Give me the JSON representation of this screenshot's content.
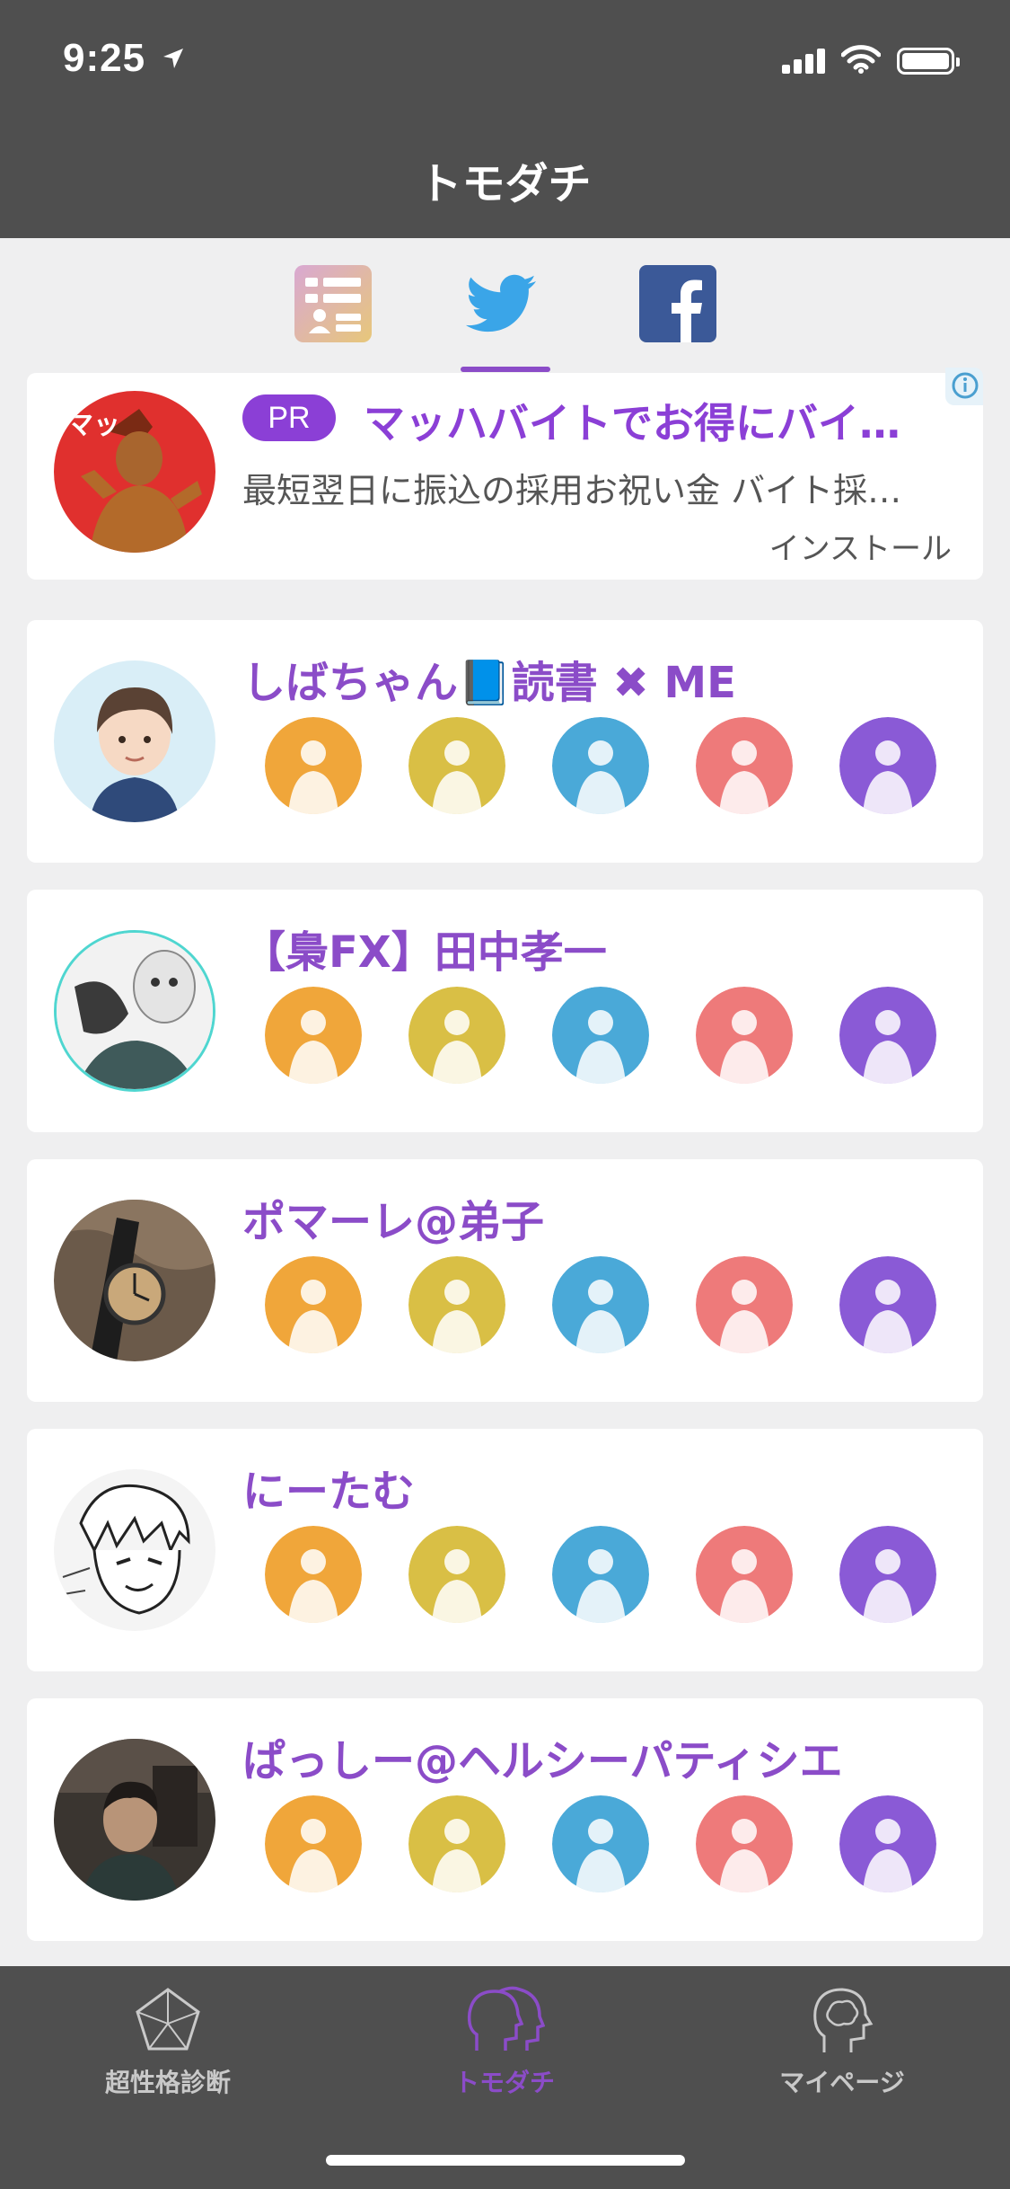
{
  "status_bar": {
    "time": "9:25"
  },
  "header": {
    "title": "トモダチ"
  },
  "top_tabs": [
    {
      "name": "profile-list",
      "icon": "profile-card-icon"
    },
    {
      "name": "twitter",
      "icon": "twitter-icon",
      "selected": true
    },
    {
      "name": "facebook",
      "icon": "facebook-icon"
    }
  ],
  "ad": {
    "badge": "PR",
    "title": "マッハバイトでお得にバイ…",
    "description": "最短翌日に振込の採用お祝い金 バイト採…",
    "install": "インストール",
    "logo_text": "マッ"
  },
  "friends": [
    {
      "name": "しばちゃん📘読書 ✖ ME",
      "type_colors": [
        "#f0a63a",
        "#d9bf45",
        "#4aa9d8",
        "#ee7a7a",
        "#8a5ad6"
      ]
    },
    {
      "name": "【梟FX】田中孝一",
      "type_colors": [
        "#f0a63a",
        "#d9bf45",
        "#4aa9d8",
        "#ee7a7a",
        "#8a5ad6"
      ]
    },
    {
      "name": "ポマーレ@弟子",
      "type_colors": [
        "#f0a63a",
        "#d9bf45",
        "#4aa9d8",
        "#ee7a7a",
        "#8a5ad6"
      ]
    },
    {
      "name": "にーたむ",
      "type_colors": [
        "#f0a63a",
        "#d9bf45",
        "#4aa9d8",
        "#ee7a7a",
        "#8a5ad6"
      ]
    },
    {
      "name": "ぱっしー@ヘルシーパティシエ",
      "type_colors": [
        "#f0a63a",
        "#d9bf45",
        "#4aa9d8",
        "#ee7a7a",
        "#8a5ad6"
      ]
    }
  ],
  "bottom_tabs": [
    {
      "label": "超性格診断",
      "icon": "pentagon-icon"
    },
    {
      "label": "トモダチ",
      "icon": "friends-heads-icon",
      "active": true
    },
    {
      "label": "マイページ",
      "icon": "brain-head-icon"
    }
  ],
  "colors": {
    "accent": "#8b4cc8",
    "header_bg": "#4f4f4f",
    "page_bg": "#efeff0"
  }
}
